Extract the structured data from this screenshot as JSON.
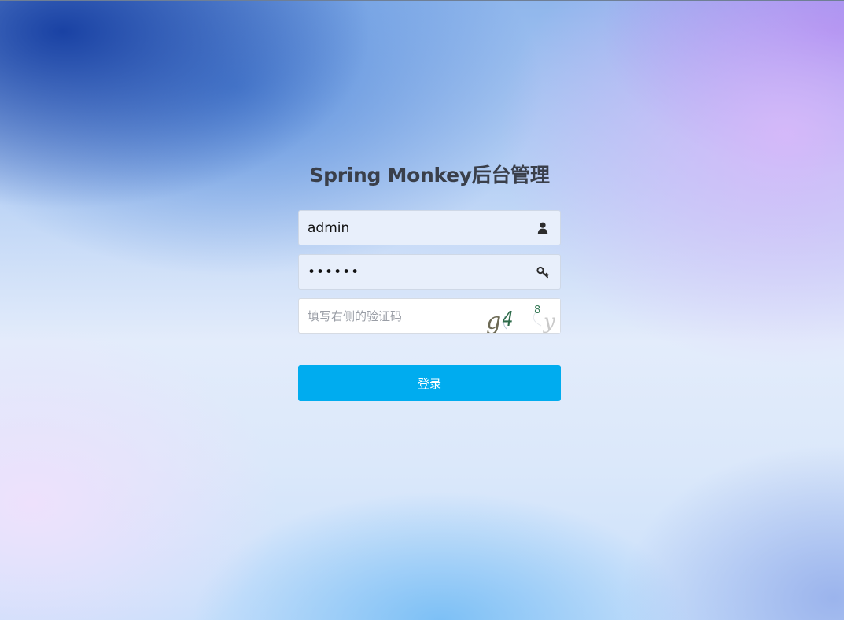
{
  "page": {
    "title": "Spring Monkey后台管理"
  },
  "form": {
    "username": {
      "value": "admin",
      "icon": "user-icon"
    },
    "password": {
      "value": "123456",
      "icon": "key-icon"
    },
    "captcha": {
      "placeholder": "填写右侧的验证码",
      "value": "",
      "image_text": "g4 8y"
    },
    "submit_label": "登录"
  },
  "colors": {
    "button": "#00acef",
    "field_background": "#e8effb",
    "title_text": "#3a3f4a"
  }
}
